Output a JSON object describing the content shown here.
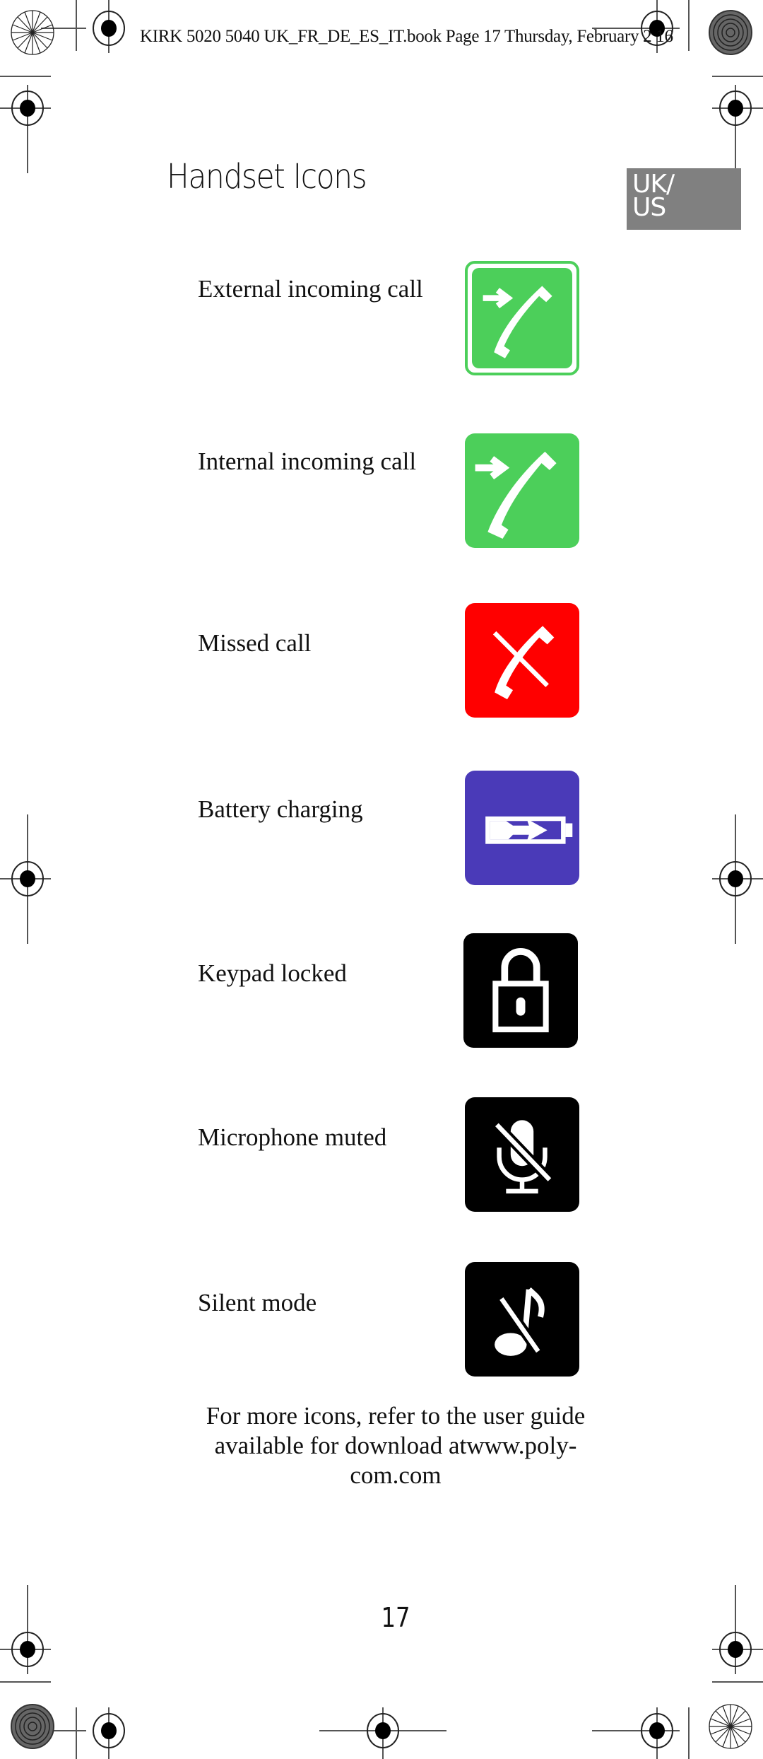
{
  "header": {
    "running_head": "KIRK 5020 5040 UK_FR_DE_ES_IT.book  Page 17  Thursday, February 2   16"
  },
  "page": {
    "title": "Handset Icons",
    "language_tab": [
      "UK/",
      "US"
    ],
    "page_number": "17",
    "footer_note": [
      "For more icons, refer to the user guide",
      "available for download atwww.poly-",
      "com.com"
    ]
  },
  "icons": [
    {
      "label": "External incoming call",
      "icon": "external-incoming-call-icon",
      "color": "#4ccf5a"
    },
    {
      "label": "Internal incoming call",
      "icon": "internal-incoming-call-icon",
      "color": "#4ccf5a"
    },
    {
      "label": "Missed call",
      "icon": "missed-call-icon",
      "color": "#ff0000"
    },
    {
      "label": "Battery charging",
      "icon": "battery-charging-icon",
      "color": "#4a3ab8"
    },
    {
      "label": "Keypad locked",
      "icon": "lock-icon",
      "color": "#000000"
    },
    {
      "label": "Microphone muted",
      "icon": "microphone-muted-icon",
      "color": "#000000"
    },
    {
      "label": "Silent mode",
      "icon": "silent-mode-icon",
      "color": "#000000"
    }
  ]
}
